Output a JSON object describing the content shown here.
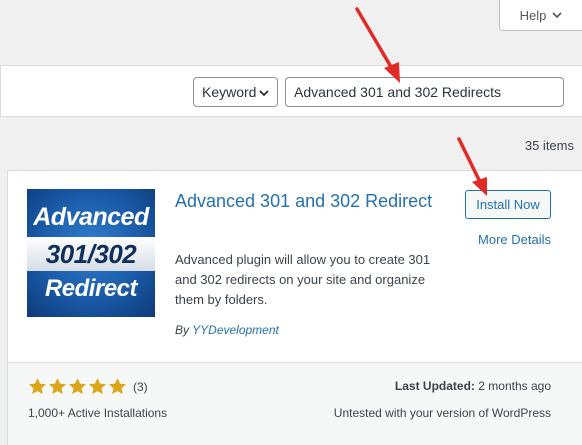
{
  "help_tab": {
    "label": "Help"
  },
  "filter": {
    "type_value": "Keyword",
    "search_value": "Advanced 301 and 302 Redirects"
  },
  "results": {
    "count_label": "35 items"
  },
  "plugin": {
    "icon_lines": [
      "Advanced",
      "301/302",
      "Redirect"
    ],
    "title": "Advanced 301 and 302 Redirect",
    "description": "Advanced plugin will allow you to create 301 and 302 redirects on your site and organize them by folders.",
    "author_prefix": "By",
    "author": "YYDevelopment",
    "install_label": "Install Now",
    "more_details_label": "More Details",
    "rating_stars": 5,
    "rating_count": "(3)",
    "active_installs": "1,000+ Active Installations",
    "last_updated_label": "Last Updated:",
    "last_updated_value": "2 months ago",
    "compatibility": "Untested with your version of WordPress"
  },
  "colors": {
    "link": "#2271b1",
    "star": "#dba617",
    "annotation_arrow": "#e02b27"
  }
}
